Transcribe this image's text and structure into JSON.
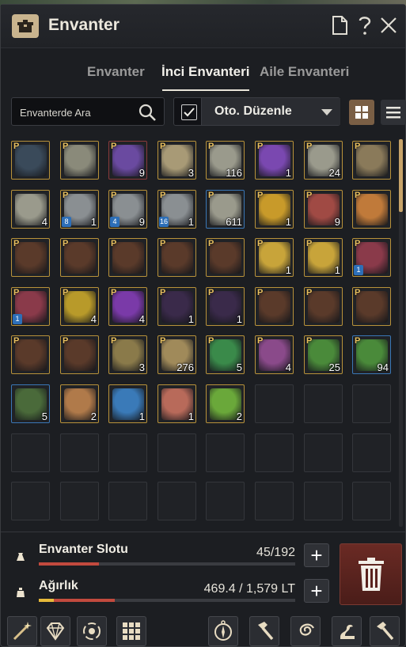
{
  "window": {
    "title": "Envanter"
  },
  "tabs": [
    {
      "label": "Envanter",
      "active": false
    },
    {
      "label": "İnci Envanteri",
      "active": true
    },
    {
      "label": "Aile Envanteri",
      "active": false
    }
  ],
  "toolbar": {
    "search_placeholder": "Envanterde Ara",
    "auto_sort_checked": true,
    "sort_label": "Oto. Düzenle"
  },
  "grid": {
    "rows": 8,
    "cols": 8,
    "items": [
      {
        "icon": "graduation-cap",
        "p": true,
        "count": "",
        "level": "",
        "border": "gold",
        "color": "#3a4a5a"
      },
      {
        "icon": "panda-outfit",
        "p": true,
        "count": "",
        "level": "",
        "border": "gold",
        "color": "#8a8a7a"
      },
      {
        "icon": "purple-scroll",
        "p": true,
        "count": "9",
        "level": "",
        "border": "red",
        "color": "#6a4aa0"
      },
      {
        "icon": "map-scroll",
        "p": true,
        "count": "3",
        "level": "",
        "border": "gold",
        "color": "#a89a76"
      },
      {
        "icon": "coupon-scroll",
        "p": true,
        "count": "116",
        "level": "",
        "border": "gold",
        "color": "#9a9a8c"
      },
      {
        "icon": "purple-orb",
        "p": true,
        "count": "1",
        "level": "",
        "border": "gold",
        "color": "#7a48b0"
      },
      {
        "icon": "coupon-scroll",
        "p": true,
        "count": "24",
        "level": "",
        "border": "gold",
        "color": "#9a9a8c"
      },
      {
        "icon": "horse-helm",
        "p": true,
        "count": "",
        "level": "",
        "border": "gold",
        "color": "#8a7a5a"
      },
      {
        "icon": "coupon-scroll",
        "p": false,
        "count": "4",
        "level": "",
        "border": "gold",
        "color": "#9a9a8c"
      },
      {
        "icon": "net-tool",
        "p": true,
        "count": "1",
        "level": "8",
        "border": "gold",
        "color": "#8a8f92"
      },
      {
        "icon": "net-tool",
        "p": true,
        "count": "9",
        "level": "4",
        "border": "gold",
        "color": "#8a8f92"
      },
      {
        "icon": "net-tool",
        "p": true,
        "count": "1",
        "level": "16",
        "border": "gold",
        "color": "#8a8f92"
      },
      {
        "icon": "coupon-scroll",
        "p": true,
        "count": "611",
        "level": "",
        "border": "blue",
        "color": "#9a9a8c"
      },
      {
        "icon": "gold-bell",
        "p": true,
        "count": "1",
        "level": "",
        "border": "gold",
        "color": "#c89a2a"
      },
      {
        "icon": "red-book",
        "p": true,
        "count": "9",
        "level": "",
        "border": "gold",
        "color": "#a04a44"
      },
      {
        "icon": "dog-pet",
        "p": true,
        "count": "",
        "level": "",
        "border": "gold",
        "color": "#c07a3a"
      },
      {
        "icon": "chest",
        "p": true,
        "count": "",
        "level": "",
        "border": "gold",
        "color": "#5a3a2a"
      },
      {
        "icon": "chest",
        "p": true,
        "count": "",
        "level": "",
        "border": "gold",
        "color": "#5a3a2a"
      },
      {
        "icon": "chest",
        "p": true,
        "count": "",
        "level": "",
        "border": "gold",
        "color": "#5a3a2a"
      },
      {
        "icon": "chest",
        "p": true,
        "count": "",
        "level": "",
        "border": "gold",
        "color": "#5a3a2a"
      },
      {
        "icon": "chest",
        "p": true,
        "count": "",
        "level": "",
        "border": "gold",
        "color": "#5a3a2a"
      },
      {
        "icon": "gold-horn",
        "p": true,
        "count": "1",
        "level": "",
        "border": "gold",
        "color": "#c8a43a"
      },
      {
        "icon": "gold-horn",
        "p": true,
        "count": "1",
        "level": "",
        "border": "gold",
        "color": "#c8a43a"
      },
      {
        "icon": "treasure-chest",
        "p": true,
        "count": "",
        "level": "1",
        "border": "gold",
        "color": "#8a3a4a"
      },
      {
        "icon": "treasure-chest",
        "p": true,
        "count": "",
        "level": "1",
        "border": "gold",
        "color": "#8a3a4a"
      },
      {
        "icon": "butterfly-orb",
        "p": true,
        "count": "4",
        "level": "",
        "border": "gold",
        "color": "#b89a2a"
      },
      {
        "icon": "purple-chest",
        "p": true,
        "count": "4",
        "level": "",
        "border": "gold",
        "color": "#7a3aa8"
      },
      {
        "icon": "dark-scroll",
        "p": true,
        "count": "1",
        "level": "",
        "border": "gold",
        "color": "#3a2a4a"
      },
      {
        "icon": "dark-scroll",
        "p": true,
        "count": "1",
        "level": "",
        "border": "gold",
        "color": "#3a2a4a"
      },
      {
        "icon": "chest",
        "p": true,
        "count": "",
        "level": "",
        "border": "gold",
        "color": "#5a3a2a"
      },
      {
        "icon": "chest",
        "p": true,
        "count": "",
        "level": "",
        "border": "gold",
        "color": "#5a3a2a"
      },
      {
        "icon": "chest",
        "p": true,
        "count": "",
        "level": "",
        "border": "gold",
        "color": "#5a3a2a"
      },
      {
        "icon": "chest",
        "p": true,
        "count": "",
        "level": "",
        "border": "gold",
        "color": "#5a3a2a"
      },
      {
        "icon": "chest",
        "p": true,
        "count": "",
        "level": "",
        "border": "gold",
        "color": "#5a3a2a"
      },
      {
        "icon": "compass",
        "p": true,
        "count": "3",
        "level": "",
        "border": "gold",
        "color": "#8a7a4a"
      },
      {
        "icon": "potion-flask",
        "p": true,
        "count": "276",
        "level": "",
        "border": "gold",
        "color": "#a08a5a"
      },
      {
        "icon": "green-potion",
        "p": true,
        "count": "5",
        "level": "",
        "border": "gold",
        "color": "#3a8a4a"
      },
      {
        "icon": "purple-vase",
        "p": true,
        "count": "4",
        "level": "",
        "border": "gold",
        "color": "#8a4a8a"
      },
      {
        "icon": "green-vase",
        "p": true,
        "count": "25",
        "level": "",
        "border": "gold",
        "color": "#4a8a3a"
      },
      {
        "icon": "green-vase",
        "p": true,
        "count": "94",
        "level": "",
        "border": "blue",
        "color": "#4a8a3a"
      },
      {
        "icon": "food-bowl",
        "p": false,
        "count": "5",
        "level": "",
        "border": "blue",
        "color": "#4a6a3a"
      },
      {
        "icon": "recipe-scroll",
        "p": false,
        "count": "2",
        "level": "",
        "border": "gold",
        "color": "#b07a4a"
      },
      {
        "icon": "blue-dish",
        "p": false,
        "count": "1",
        "level": "",
        "border": "gold",
        "color": "#3a7ab8"
      },
      {
        "icon": "red-dish",
        "p": false,
        "count": "1",
        "level": "",
        "border": "gold",
        "color": "#b86a5a"
      },
      {
        "icon": "green-leaf",
        "p": false,
        "count": "2",
        "level": "",
        "border": "gold",
        "color": "#6aa83a"
      }
    ]
  },
  "slots": {
    "label": "Envanter Slotu",
    "used": "45",
    "total": "192",
    "fill": 0.234
  },
  "weight": {
    "label": "Ağırlık",
    "value": "469.4 / 1,579 LT",
    "fill": 0.297
  },
  "colors": {
    "accent": "#c7a46a",
    "slot_bar": "#c24a3e",
    "weight_bar_a": "#e7b93a",
    "weight_bar_b": "#c24a3e",
    "trash": "#5a221d"
  },
  "bottom_bar": [
    "magic-wand-icon",
    "diamond-icon",
    "cycle-gems-icon",
    "grid-tiles-icon",
    "compass-rose-icon",
    "hammer-icon",
    "swirl-icon",
    "dragon-icon",
    "repair-hammer-icon"
  ]
}
